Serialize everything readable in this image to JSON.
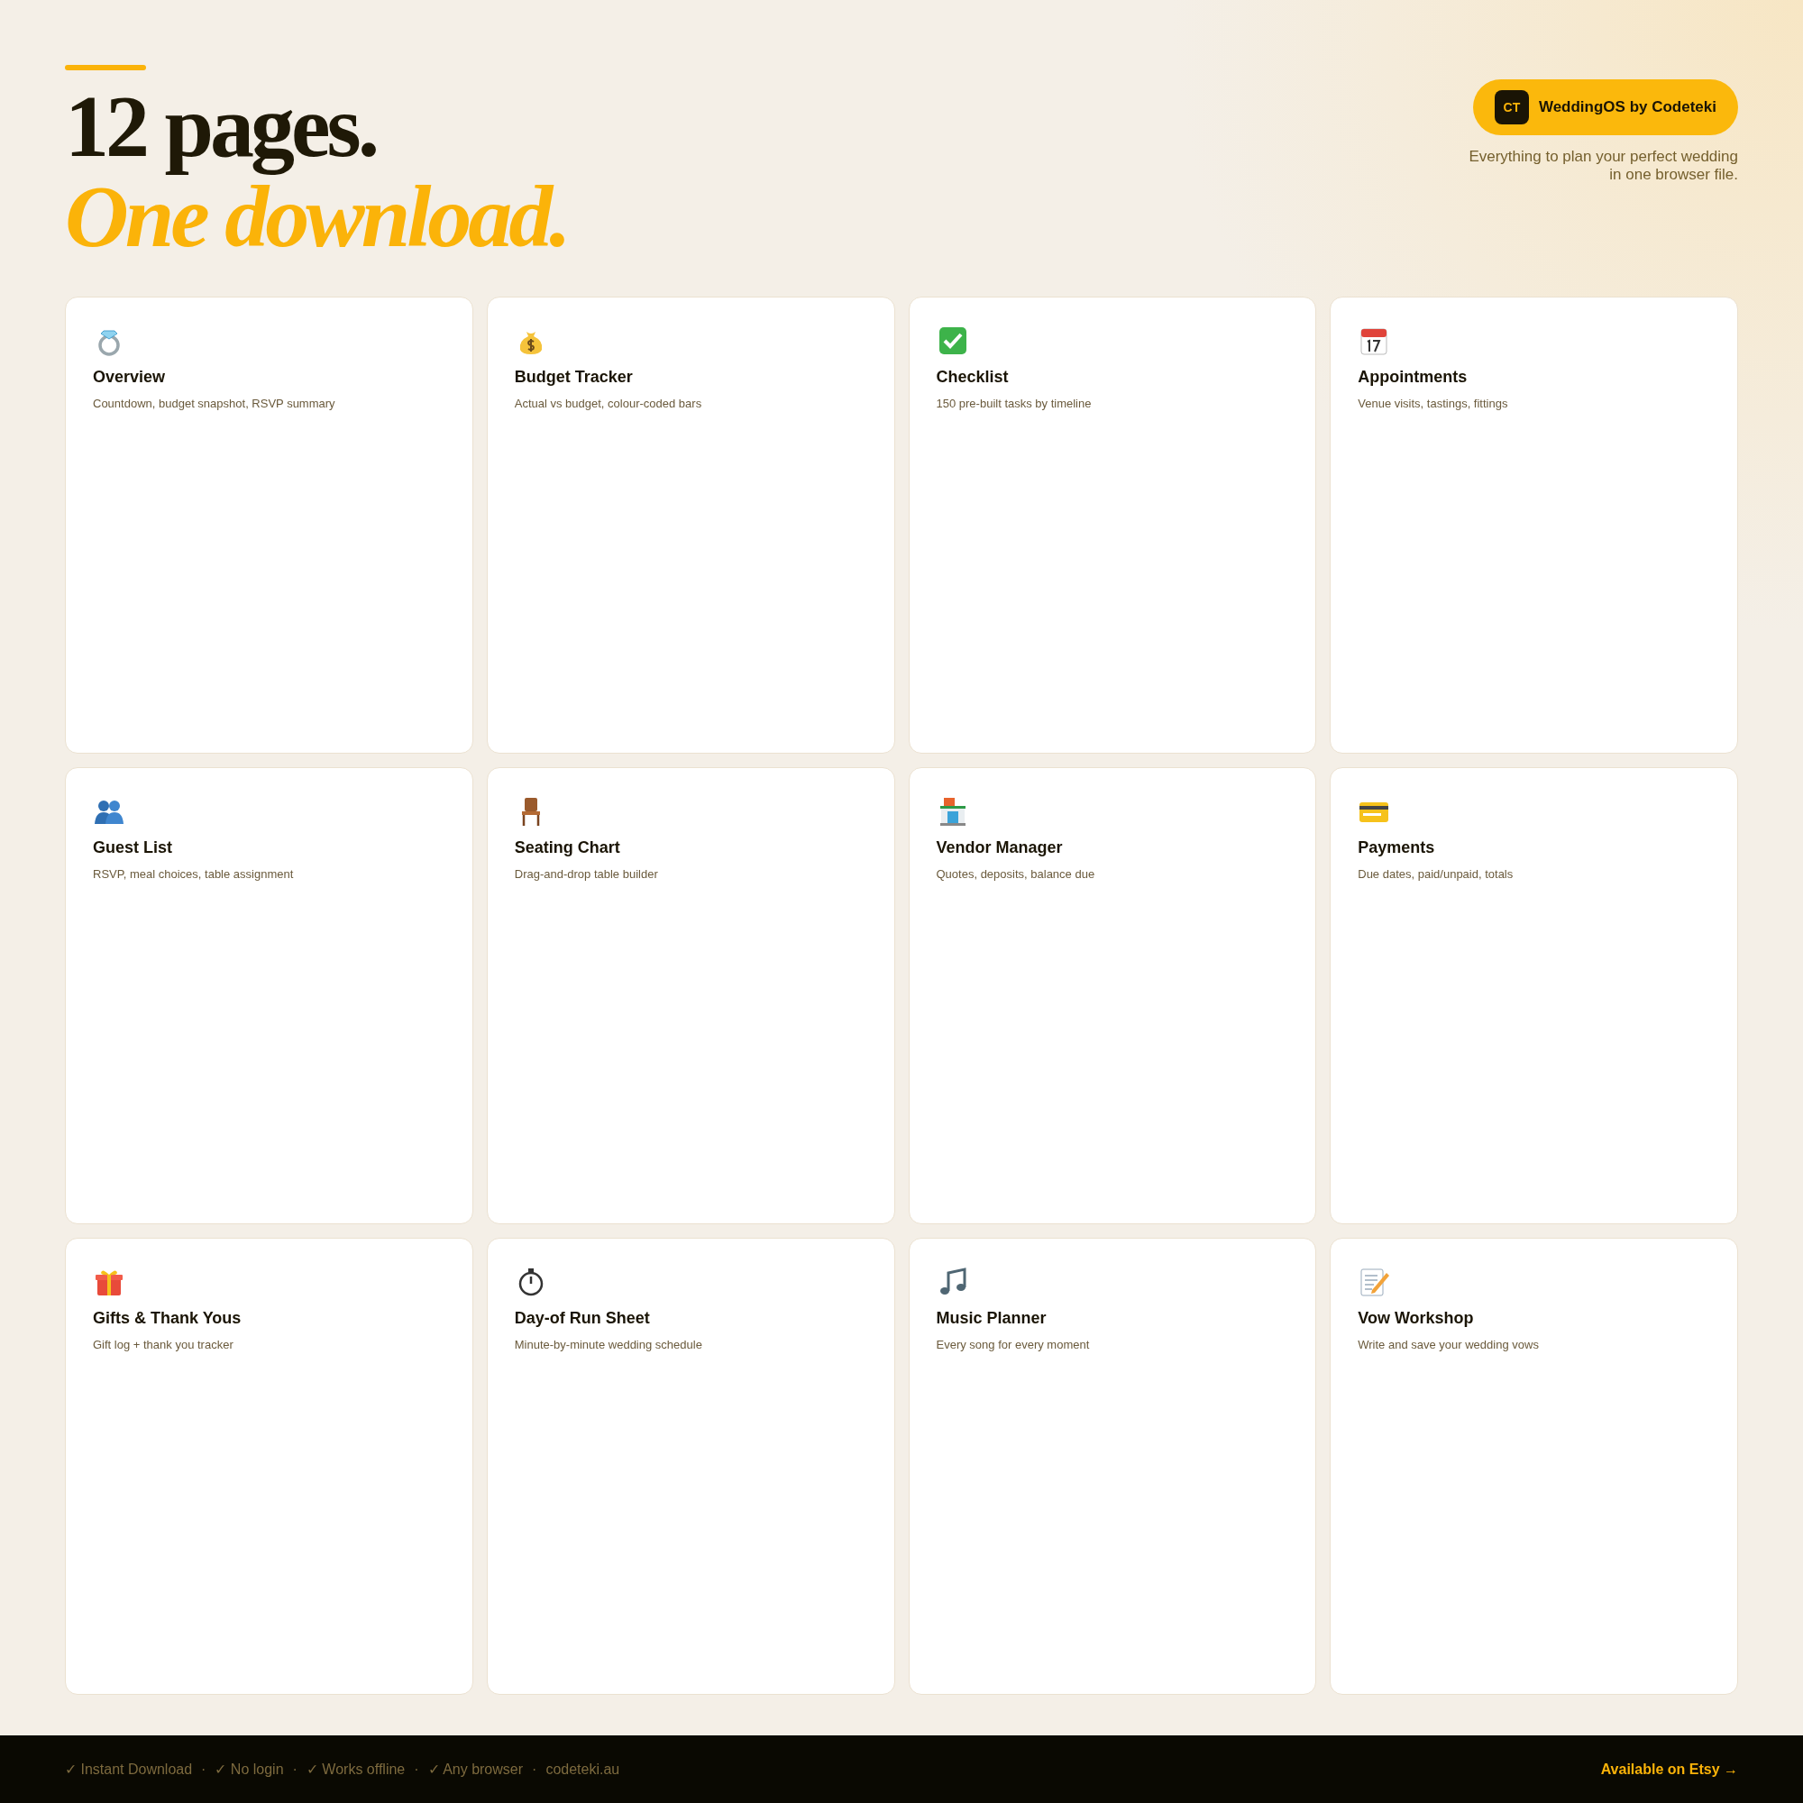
{
  "header": {
    "headline": "12 pages.",
    "headline_accent": "One download.",
    "badge": {
      "logo": "CT",
      "label": "WeddingOS by Codeteki"
    },
    "tagline": "Everything to plan your perfect wedding in one browser file."
  },
  "cards": [
    {
      "title": "Overview",
      "description": "Countdown, budget snapshot, RSVP summary"
    },
    {
      "title": "Budget Tracker",
      "description": "Actual vs budget, colour-coded bars"
    },
    {
      "title": "Checklist",
      "description": "150 pre-built tasks by timeline"
    },
    {
      "title": "Appointments",
      "description": "Venue visits, tastings, fittings"
    },
    {
      "title": "Guest List",
      "description": "RSVP, meal choices, table assignment"
    },
    {
      "title": "Seating Chart",
      "description": "Drag-and-drop table builder"
    },
    {
      "title": "Vendor Manager",
      "description": "Quotes, deposits, balance due"
    },
    {
      "title": "Payments",
      "description": "Due dates, paid/unpaid, totals"
    },
    {
      "title": "Gifts & Thank Yous",
      "description": "Gift log + thank you tracker"
    },
    {
      "title": "Day-of Run Sheet",
      "description": "Minute-by-minute wedding schedule"
    },
    {
      "title": "Music Planner",
      "description": "Every song for every moment"
    },
    {
      "title": "Vow Workshop",
      "description": "Write and save your wedding vows"
    }
  ],
  "footer": {
    "features": [
      "✓ Instant Download",
      "✓ No login",
      "✓ Works offline",
      "✓ Any browser",
      "codeteki.au"
    ],
    "separator": "·",
    "cta": "Available on Etsy →"
  }
}
